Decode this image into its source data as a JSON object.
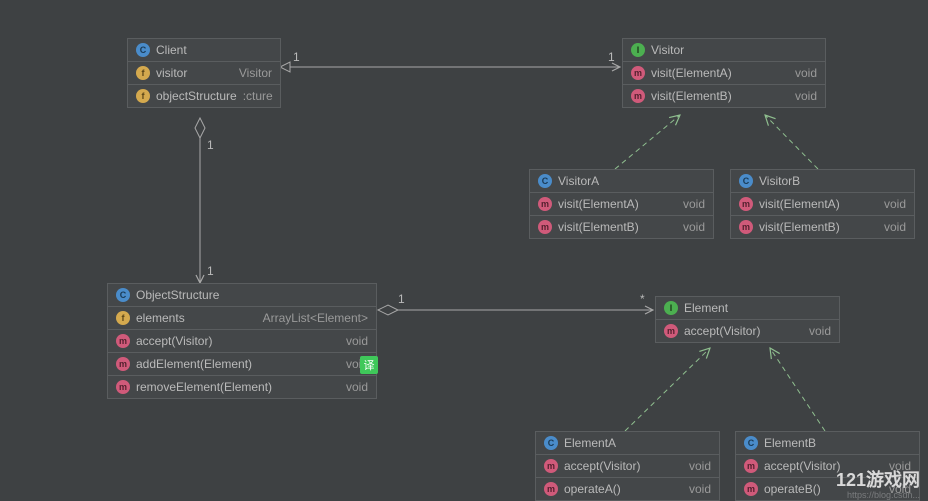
{
  "classes": {
    "client": {
      "name": "Client",
      "icon": "c",
      "rows": [
        {
          "icon": "f",
          "label": "visitor",
          "type": "Visitor"
        },
        {
          "icon": "f",
          "label": "objectStructure",
          "type": ":cture"
        }
      ]
    },
    "visitor": {
      "name": "Visitor",
      "icon": "i",
      "rows": [
        {
          "icon": "ab",
          "label": "visit(ElementA)",
          "type": "void"
        },
        {
          "icon": "ab",
          "label": "visit(ElementB)",
          "type": "void"
        }
      ]
    },
    "visitorA": {
      "name": "VisitorA",
      "icon": "c",
      "rows": [
        {
          "icon": "m",
          "label": "visit(ElementA)",
          "type": "void"
        },
        {
          "icon": "m",
          "label": "visit(ElementB)",
          "type": "void"
        }
      ]
    },
    "visitorB": {
      "name": "VisitorB",
      "icon": "c",
      "rows": [
        {
          "icon": "m",
          "label": "visit(ElementA)",
          "type": "void"
        },
        {
          "icon": "m",
          "label": "visit(ElementB)",
          "type": "void"
        }
      ]
    },
    "objectStructure": {
      "name": "ObjectStructure",
      "icon": "c",
      "rows": [
        {
          "icon": "f",
          "label": "elements",
          "type": "ArrayList<Element>"
        },
        {
          "icon": "m",
          "label": "accept(Visitor)",
          "type": "void"
        },
        {
          "icon": "m",
          "label": "addElement(Element)",
          "type": "void",
          "badge": "译"
        },
        {
          "icon": "m",
          "label": "removeElement(Element)",
          "type": "void"
        }
      ]
    },
    "element": {
      "name": "Element",
      "icon": "i",
      "rows": [
        {
          "icon": "ab",
          "label": "accept(Visitor)",
          "type": "void"
        }
      ]
    },
    "elementA": {
      "name": "ElementA",
      "icon": "c",
      "rows": [
        {
          "icon": "m",
          "label": "accept(Visitor)",
          "type": "void"
        },
        {
          "icon": "m",
          "label": "operateA()",
          "type": "void"
        }
      ]
    },
    "elementB": {
      "name": "ElementB",
      "icon": "c",
      "rows": [
        {
          "icon": "m",
          "label": "accept(Visitor)",
          "type": "void"
        },
        {
          "icon": "m",
          "label": "operateB()",
          "type": "void"
        }
      ]
    }
  },
  "multiplicities": {
    "client_visitor_left": "1",
    "client_visitor_right": "1",
    "client_obj_top": "1",
    "client_obj_bottom": "1",
    "obj_elem_left": "1",
    "obj_elem_right": "*"
  },
  "watermark": "121游戏网",
  "watermark_url": "https://blog.csdn..."
}
